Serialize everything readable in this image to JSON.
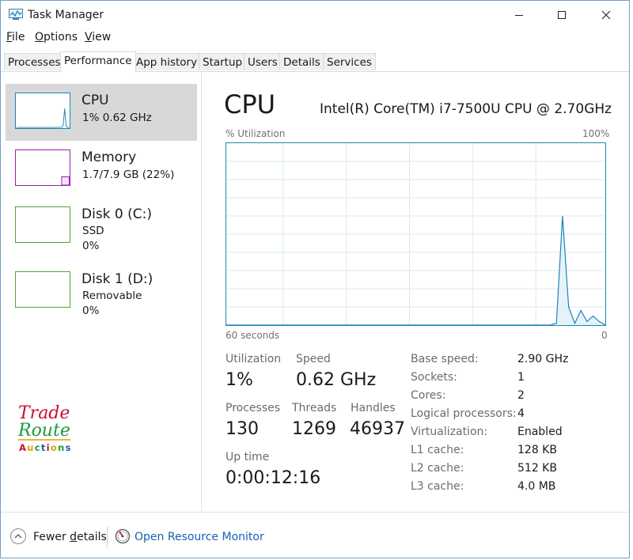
{
  "window": {
    "title": "Task Manager"
  },
  "window_controls": {
    "minimize": "minimize",
    "maximize": "maximize",
    "close": "close"
  },
  "menu": [
    {
      "label": "File",
      "accel": "F",
      "rest": "ile"
    },
    {
      "label": "Options",
      "accel": "O",
      "rest": "ptions"
    },
    {
      "label": "View",
      "accel": "V",
      "rest": "iew"
    }
  ],
  "tabs": [
    "Processes",
    "Performance",
    "App history",
    "Startup",
    "Users",
    "Details",
    "Services"
  ],
  "active_tab": "Performance",
  "sidebar": [
    {
      "title": "CPU",
      "line1": "1% 0.62 GHz",
      "line2": "",
      "color": "#1a85b8",
      "selected": true
    },
    {
      "title": "Memory",
      "line1": "1.7/7.9 GB (22%)",
      "line2": "",
      "color": "#9b1bb3",
      "selected": false
    },
    {
      "title": "Disk 0 (C:)",
      "line1": "SSD",
      "line2": "0%",
      "color": "#4da832",
      "selected": false
    },
    {
      "title": "Disk 1 (D:)",
      "line1": "Removable",
      "line2": "0%",
      "color": "#4da832",
      "selected": false
    }
  ],
  "logo": {
    "line1": "Trade",
    "line2": "Route",
    "line3": "Auctions"
  },
  "main": {
    "title": "CPU",
    "model": "Intel(R) Core(TM) i7-7500U CPU @ 2.70GHz",
    "graph": {
      "y_label": "% Utilization",
      "y_max_label": "100%",
      "x_left_label": "60 seconds",
      "x_right_label": "0",
      "samples": [
        0,
        0,
        0,
        0,
        0,
        0,
        0,
        0,
        0,
        0,
        0,
        0,
        0,
        0,
        0,
        0,
        0,
        0,
        0,
        0,
        0,
        0,
        0,
        0,
        0,
        0,
        0,
        0,
        0,
        0,
        0,
        0,
        0,
        0,
        0,
        0,
        0,
        0,
        0,
        0,
        0,
        0,
        0,
        0,
        0,
        0,
        0,
        0,
        0,
        0,
        0,
        0,
        0,
        0,
        1,
        60,
        10,
        1,
        8,
        2,
        5,
        2,
        0
      ],
      "color": "#1a85b8"
    },
    "stats": {
      "utilization": {
        "label": "Utilization",
        "value": "1%"
      },
      "speed": {
        "label": "Speed",
        "value": "0.62 GHz"
      },
      "processes": {
        "label": "Processes",
        "value": "130"
      },
      "threads": {
        "label": "Threads",
        "value": "1269"
      },
      "handles": {
        "label": "Handles",
        "value": "46937"
      },
      "uptime": {
        "label": "Up time",
        "value": "0:00:12:16"
      }
    },
    "info": [
      {
        "label": "Base speed:",
        "value": "2.90 GHz"
      },
      {
        "label": "Sockets:",
        "value": "1"
      },
      {
        "label": "Cores:",
        "value": "2"
      },
      {
        "label": "Logical processors:",
        "value": "4"
      },
      {
        "label": "Virtualization:",
        "value": "Enabled"
      },
      {
        "label": "L1 cache:",
        "value": "128 KB"
      },
      {
        "label": "L2 cache:",
        "value": "512 KB"
      },
      {
        "label": "L3 cache:",
        "value": "4.0 MB"
      }
    ]
  },
  "footer": {
    "fewer_details_accel": "d",
    "fewer_details_pre": "Fewer ",
    "fewer_details_post": "etails",
    "open_resource_monitor": "Open Resource Monitor"
  }
}
